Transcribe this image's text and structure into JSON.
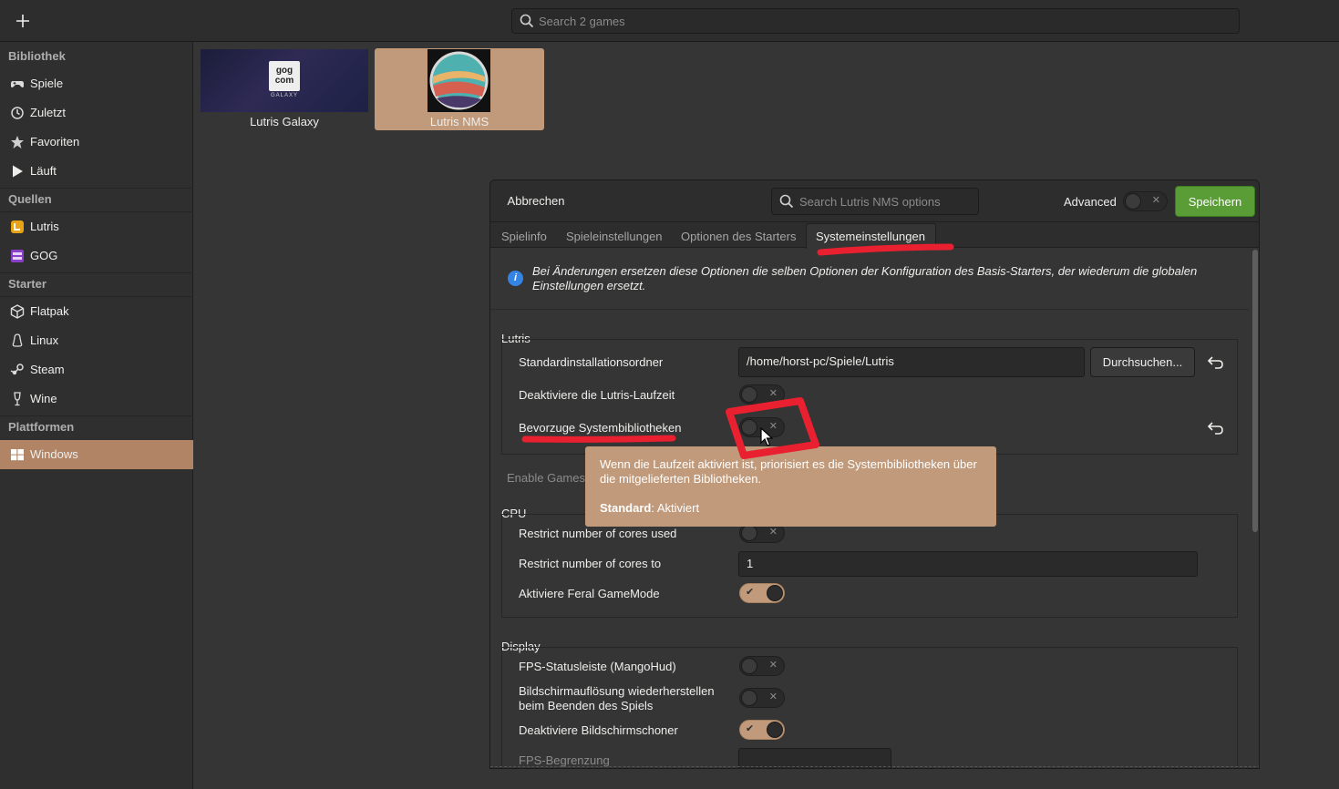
{
  "header": {
    "add_icon": "plus-icon",
    "search_placeholder": "Search 2 games"
  },
  "sidebar": {
    "sections": [
      {
        "title": "Bibliothek",
        "items": [
          {
            "label": "Spiele",
            "icon": "gamepad-icon"
          },
          {
            "label": "Zuletzt",
            "icon": "clock-icon"
          },
          {
            "label": "Favoriten",
            "icon": "star-icon"
          },
          {
            "label": "Läuft",
            "icon": "play-icon"
          }
        ]
      },
      {
        "title": "Quellen",
        "items": [
          {
            "label": "Lutris",
            "icon": "lutris-icon"
          },
          {
            "label": "GOG",
            "icon": "gog-icon"
          }
        ]
      },
      {
        "title": "Starter",
        "items": [
          {
            "label": "Flatpak",
            "icon": "flatpak-icon"
          },
          {
            "label": "Linux",
            "icon": "linux-icon"
          },
          {
            "label": "Steam",
            "icon": "steam-icon"
          },
          {
            "label": "Wine",
            "icon": "wine-icon"
          }
        ]
      },
      {
        "title": "Plattformen",
        "items": [
          {
            "label": "Windows",
            "icon": "windows-icon",
            "active": true
          }
        ]
      }
    ]
  },
  "games": [
    {
      "title": "Lutris Galaxy",
      "logo_top": "gog",
      "logo_mid": "com",
      "logo_sub": "GALAXY"
    },
    {
      "title": "Lutris NMS",
      "selected": true
    }
  ],
  "dialog": {
    "cancel_label": "Abbrechen",
    "search_placeholder": "Search Lutris NMS options",
    "advanced_label": "Advanced",
    "save_label": "Speichern",
    "tabs": [
      "Spielinfo",
      "Spieleinstellungen",
      "Optionen des Starters",
      "Systemeinstellungen"
    ],
    "active_tab": "Systemeinstellungen",
    "info_text": "Bei Änderungen ersetzen diese Optionen die selben Optionen der Konfiguration des Basis-Starters, der wiederum die globalen Einstellungen ersetzt.",
    "lutris": {
      "title": "Lutris",
      "install_dir_label": "Standardinstallationsordner",
      "install_dir_value": "/home/horst-pc/Spiele/Lutris",
      "browse_label": "Durchsuchen...",
      "disable_runtime_label": "Deaktiviere die Lutris-Laufzeit",
      "prefer_syslibs_label": "Bevorzuge Systembibliotheken",
      "enable_games_label": "Enable Games"
    },
    "cpu": {
      "title": "CPU",
      "restrict_cores_label": "Restrict number of cores used",
      "restrict_cores_to_label": "Restrict number of cores to",
      "restrict_cores_to_value": "1",
      "gamemode_label": "Aktiviere Feral GameMode"
    },
    "display": {
      "title": "Display",
      "mangohud_label": "FPS-Statusleiste (MangoHud)",
      "restore_res_label_1": "Bildschirmauflösung wiederherstellen",
      "restore_res_label_2": "beim Beenden des Spiels",
      "disable_screensaver_label": "Deaktiviere Bildschirmschoner",
      "fps_limit_label": "FPS-Begrenzung"
    },
    "tooltip": {
      "line1": "Wenn die Laufzeit aktiviert ist, priorisiert es die Systembibliotheken über die mitgelieferten Bibliotheken.",
      "default_label": "Standard",
      "default_value": ": Aktiviert"
    }
  },
  "colors": {
    "accent": "#c09a7a",
    "sidebar_active": "#b08464",
    "save_green": "#5a9c36",
    "annotation_red": "#e8202f"
  }
}
